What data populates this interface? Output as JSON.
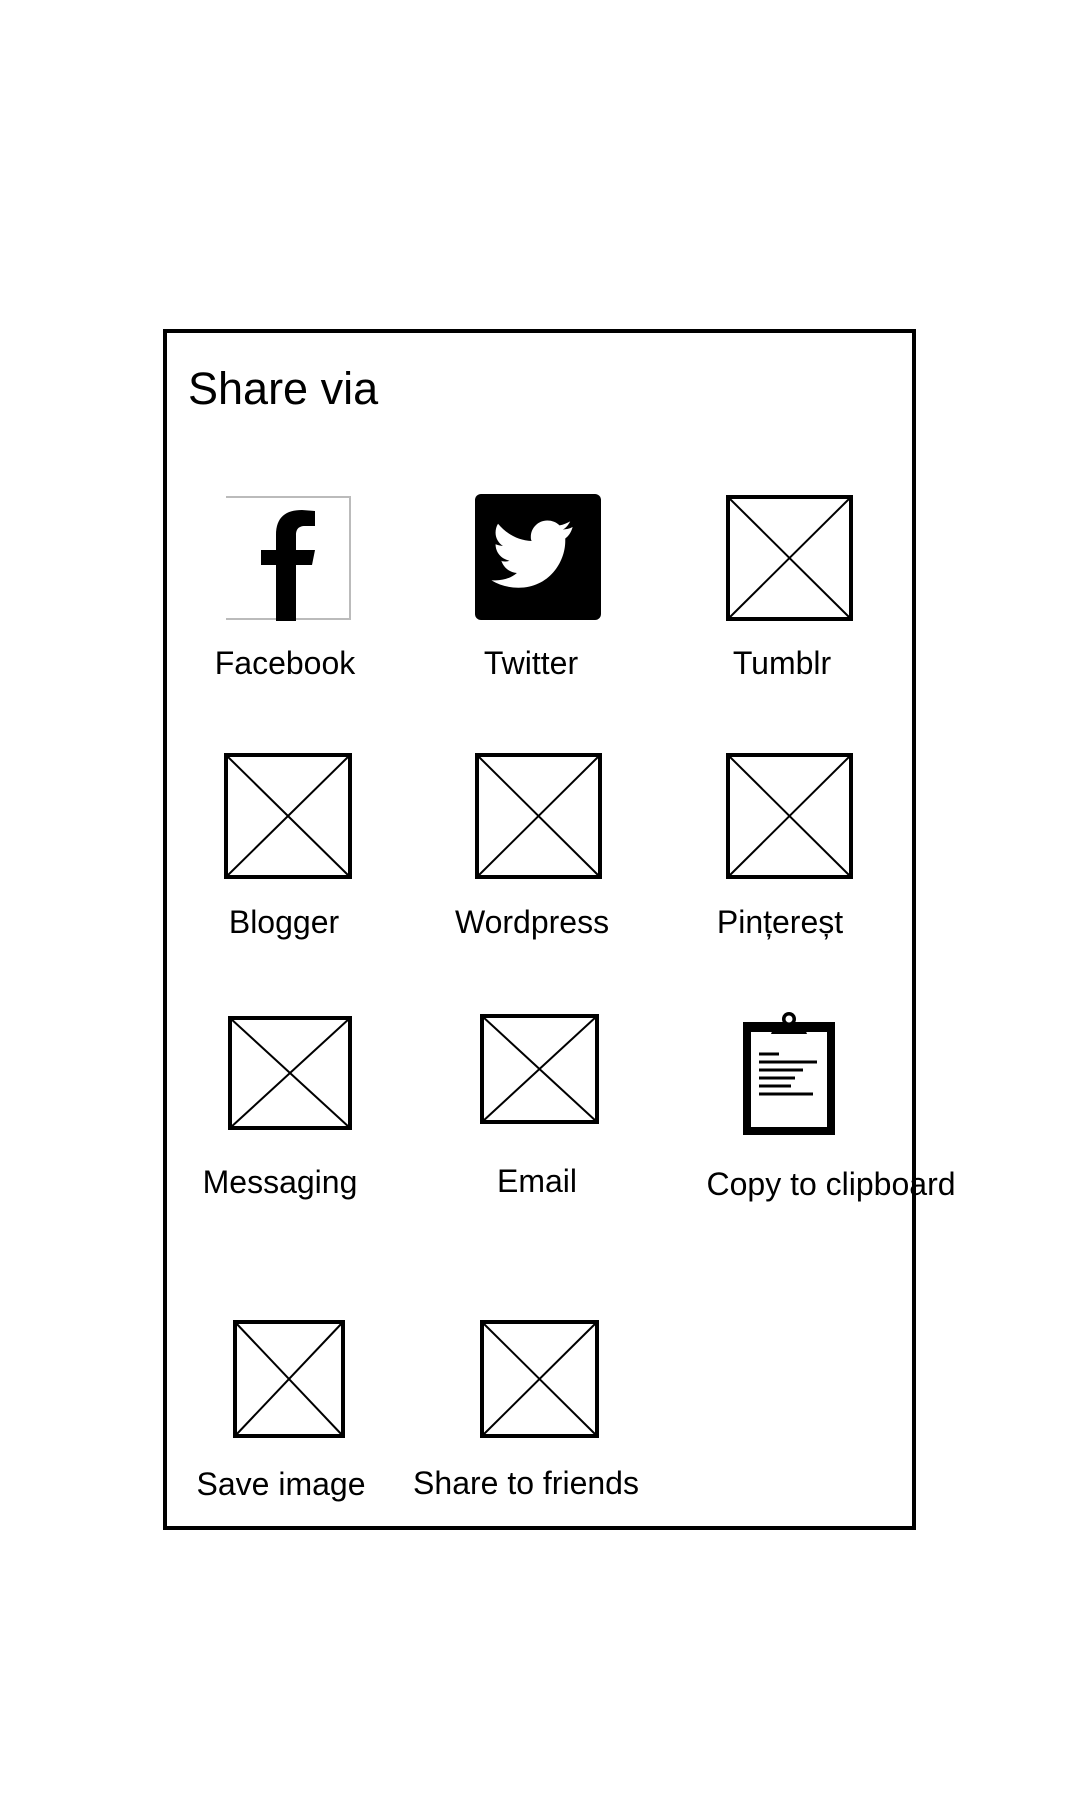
{
  "dialog": {
    "title": "Share via"
  },
  "items": [
    {
      "label": "Facebook",
      "icon": "facebook-icon"
    },
    {
      "label": "Twitter",
      "icon": "twitter-icon"
    },
    {
      "label": "Tumblr",
      "icon": "image-placeholder-icon"
    },
    {
      "label": "Blogger",
      "icon": "image-placeholder-icon"
    },
    {
      "label": "Wordpress",
      "icon": "image-placeholder-icon"
    },
    {
      "label": "Pințereșt",
      "icon": "image-placeholder-icon"
    },
    {
      "label": "Messaging",
      "icon": "image-placeholder-icon"
    },
    {
      "label": "Email",
      "icon": "image-placeholder-icon"
    },
    {
      "label": "Copy to clipboard",
      "icon": "clipboard-icon"
    },
    {
      "label": "Save image",
      "icon": "image-placeholder-icon"
    },
    {
      "label": "Share to friends",
      "icon": "image-placeholder-icon"
    }
  ]
}
